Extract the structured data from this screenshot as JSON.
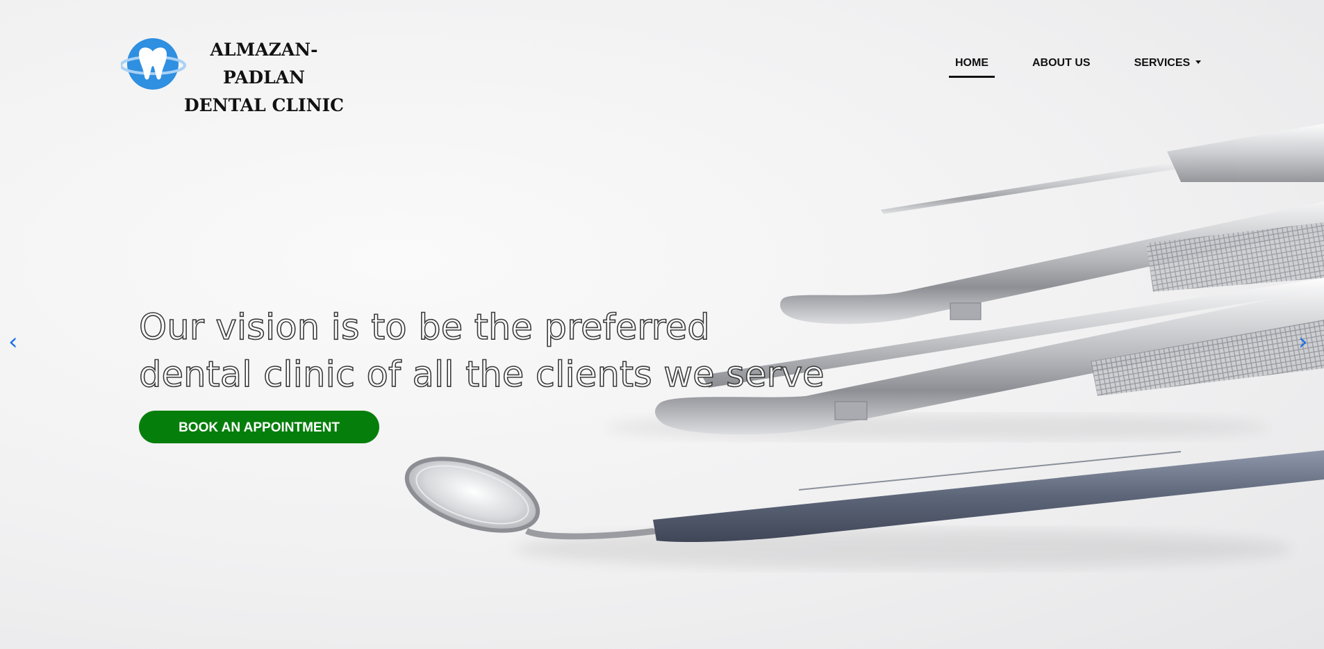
{
  "brand": {
    "line1": "ALMAZAN-PADLAN",
    "line2": "DENTAL CLINIC"
  },
  "nav": {
    "items": [
      {
        "label": "HOME",
        "active": true
      },
      {
        "label": "ABOUT US",
        "active": false
      },
      {
        "label": "SERVICES",
        "active": false,
        "dropdown": true
      }
    ]
  },
  "hero": {
    "headline_line1": "Our vision is to be the preferred",
    "headline_line2": "dental clinic of all the clients we serve",
    "cta_label": "BOOK AN APPOINTMENT",
    "prev_arrow": "‹",
    "next_arrow": "›"
  },
  "colors": {
    "cta_background": "#067e0b",
    "arrow": "#1a6fe6",
    "logo_blue": "#2f8fe0"
  }
}
